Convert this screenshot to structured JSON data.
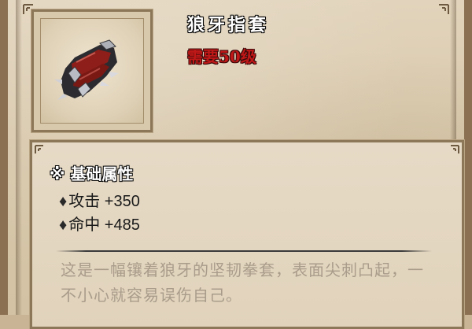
{
  "item": {
    "name": "狼牙指套",
    "requirement": "需要50级",
    "icon": "spiked-gauntlet-icon"
  },
  "attributes": {
    "header": "※ 基础属性",
    "bullet": "♦",
    "stats": [
      {
        "label": "攻击 +350"
      },
      {
        "label": "命中 +485"
      }
    ]
  },
  "description": "这是一幅镶着狼牙的坚韧拳套，表面尖刺凸起，一不小心就容易误伤自己。",
  "colors": {
    "parchment": "#e2d4bc",
    "frame": "#8d7759",
    "requirement_red": "#c01818",
    "description_gray": "#a99c8a"
  }
}
